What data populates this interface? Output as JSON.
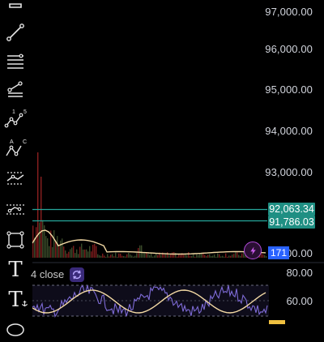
{
  "price_axis": {
    "labels": [
      "97,000.00",
      "96,000.00",
      "95,000.00",
      "94,000.00",
      "93,000.00"
    ],
    "partial_label": "00.00"
  },
  "price_tags": {
    "upper": "92,063.34",
    "lower": "91,786.03"
  },
  "volume_badge": "171",
  "indicator": {
    "legend_text": "4 close"
  },
  "oscillator_axis": {
    "labels": [
      "80.00",
      "60.00"
    ]
  },
  "toolbar": {
    "text_tool_glyph": "T",
    "anchored_text_glyph": "T",
    "pitchfork_labels": [
      "1",
      "5"
    ],
    "abc_labels": [
      "A",
      "C"
    ]
  },
  "colors": {
    "teal_line": "#26a69a",
    "price_tag_bg": "#1f8f83",
    "volume_badge_bg": "#2962ff",
    "ma_line": "#f3d9a4",
    "rsi_line": "#7e6bd6",
    "rsi_ma_line": "#f0c040",
    "volume_bar": "#8a1f1f"
  }
}
